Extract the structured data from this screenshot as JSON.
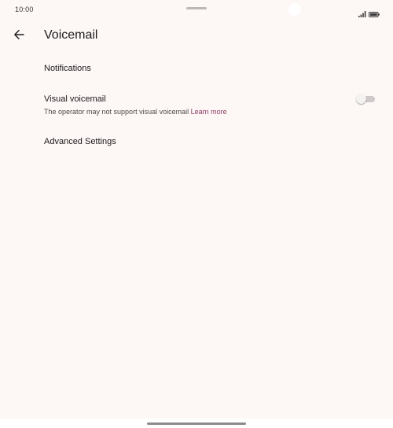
{
  "status_bar": {
    "time": "10:00",
    "signal_icon": "signal-icon",
    "battery_icon": "battery-icon"
  },
  "app_bar": {
    "back_icon": "arrow-back-icon",
    "title": "Voicemail"
  },
  "preferences": {
    "notifications": {
      "title": "Notifications"
    },
    "visual_voicemail": {
      "title": "Visual voicemail",
      "summary": "The operator may not support visual voicemail ",
      "link": "Learn more",
      "enabled": false
    },
    "advanced": {
      "title": "Advanced Settings"
    }
  },
  "colors": {
    "background": "#fdf7f6",
    "link": "#8b3a63",
    "toggle_off_track": "#cfc9c9"
  }
}
